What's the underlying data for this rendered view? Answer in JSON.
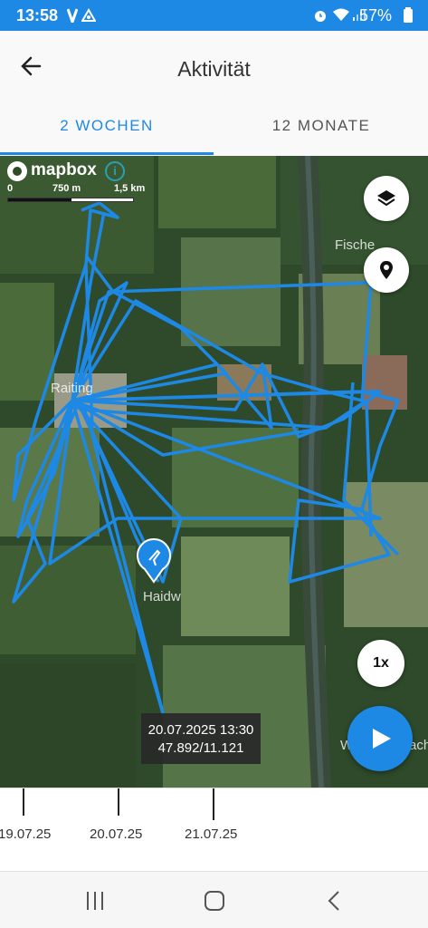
{
  "status_bar": {
    "time": "13:58",
    "battery": "57%",
    "icons": [
      "v-app-icon",
      "triangle-app-icon",
      "alarm-icon",
      "wifi-icon",
      "signal-icon",
      "battery-icon"
    ]
  },
  "header": {
    "title": "Aktivität",
    "back_icon": "arrow-left-icon"
  },
  "tabs": [
    {
      "label": "2 WOCHEN",
      "active": true
    },
    {
      "label": "12 MONATE",
      "active": false
    }
  ],
  "map": {
    "attribution": "mapbox",
    "scale": {
      "zero": "0",
      "mid": "750 m",
      "max": "1,5 km"
    },
    "place_labels": [
      "Fische",
      "Raiting",
      "Haidw",
      "W",
      "ach"
    ],
    "layers_icon": "layers-icon",
    "location_icon": "location-pin-icon",
    "speed": "1x",
    "play_icon": "play-icon",
    "marker_icon": "bird-marker-icon",
    "tooltip": {
      "datetime": "20.07.2025 13:30",
      "coords": "47.892/11.121"
    },
    "track_color": "#1e88e5"
  },
  "timeline": {
    "labels": [
      "19.07.25",
      "20.07.25",
      "21.07.25"
    ]
  },
  "nav_bar": {
    "icons": [
      "recent-apps-icon",
      "home-icon",
      "back-icon"
    ]
  },
  "colors": {
    "accent": "#1e88e5",
    "status_bar": "#1e88e5"
  }
}
